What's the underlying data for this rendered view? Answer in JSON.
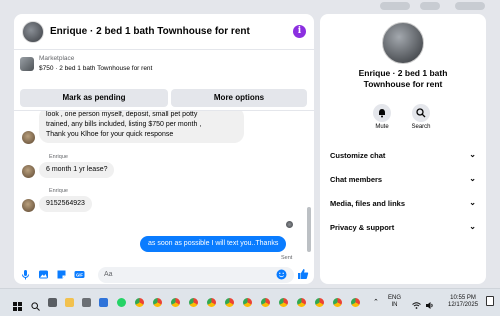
{
  "header": {
    "title": "Enrique · 2 bed 1 bath Townhouse for rent"
  },
  "listing": {
    "label": "Marketplace",
    "title": "$750 · 2 bed 1 bath Townhouse for rent",
    "pending_button": "Mark as pending",
    "more_button": "More options"
  },
  "messages": {
    "partial_line": "look , one person myself, deposit, small pet potty",
    "partial_rest": "trained, any bills included, listing $750 per month ,",
    "partial_last": "Thank you Klhoe for your quick response",
    "sender1": "Enrique",
    "msg1": "6 month 1 yr lease?",
    "sender2": "Enrique",
    "msg2": "9152564923",
    "outgoing": "as soon as possible I will text you..Thanks",
    "status": "Sent"
  },
  "composer": {
    "placeholder": "Aa"
  },
  "sidebar": {
    "title": "Enrique · 2 bed 1 bath Townhouse for rent",
    "mute": "Mute",
    "search": "Search",
    "menu": [
      "Customize chat",
      "Chat members",
      "Media, files and links",
      "Privacy & support"
    ]
  },
  "taskbar": {
    "lang1": "ENG",
    "lang2": "IN",
    "time": "10:55 PM",
    "date": "12/17/2025"
  },
  "colors": {
    "accent": "#0a7cff",
    "info": "#8b2fe0"
  }
}
